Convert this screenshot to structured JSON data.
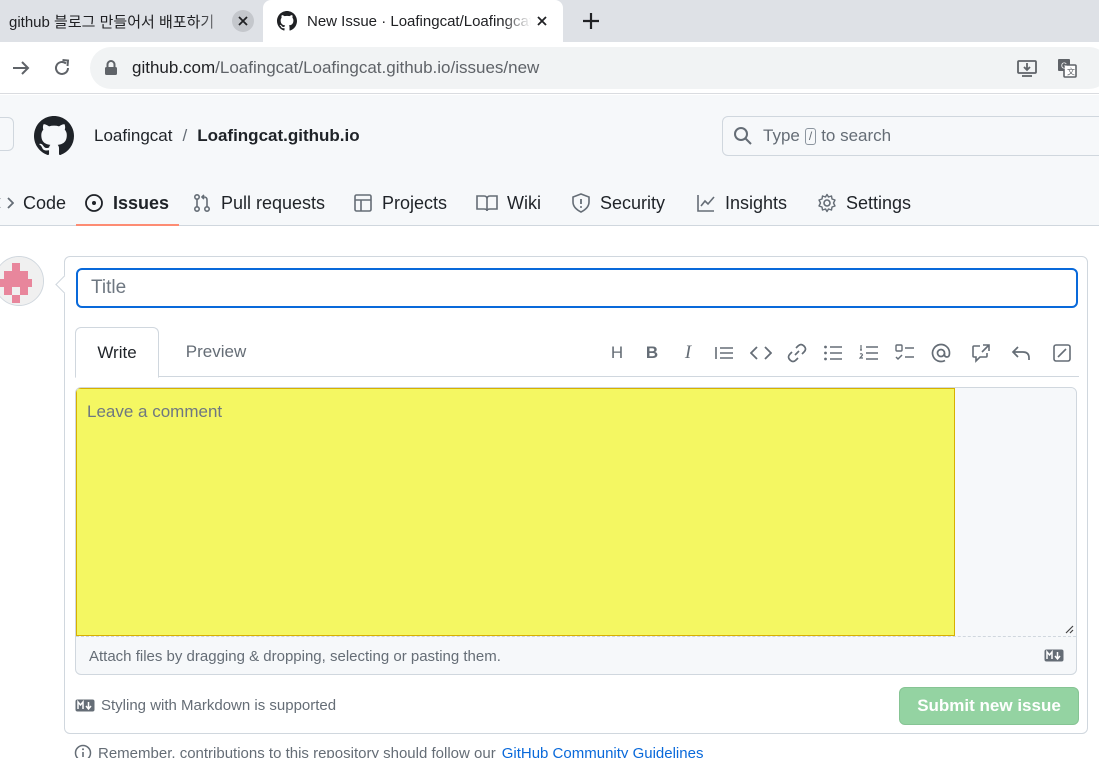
{
  "browser": {
    "tabs": [
      {
        "title": "github 블로그 만들어서 배포하기"
      },
      {
        "title": "New Issue · Loafingcat/Loafingcat.github.io"
      }
    ],
    "url_host": "github.com",
    "url_path": "/Loafingcat/Loafingcat.github.io/issues/new"
  },
  "header": {
    "owner": "Loafingcat",
    "separator": "/",
    "repo": "Loafingcat.github.io",
    "search_prefix": "Type",
    "search_key": "/",
    "search_suffix": "to search"
  },
  "repo_nav": [
    {
      "label": "Code",
      "icon": "code-icon"
    },
    {
      "label": "Issues",
      "icon": "issue-opened-icon",
      "selected": true
    },
    {
      "label": "Pull requests",
      "icon": "pull-request-icon"
    },
    {
      "label": "Projects",
      "icon": "table-icon"
    },
    {
      "label": "Wiki",
      "icon": "book-icon"
    },
    {
      "label": "Security",
      "icon": "shield-icon"
    },
    {
      "label": "Insights",
      "icon": "graph-icon"
    },
    {
      "label": "Settings",
      "icon": "gear-icon"
    }
  ],
  "form": {
    "title_placeholder": "Title",
    "title_value": "",
    "tab_write": "Write",
    "tab_preview": "Preview",
    "comment_placeholder": "Leave a comment",
    "attach_text": "Attach files by dragging & dropping, selecting or pasting them.",
    "markdown_note": "Styling with Markdown is supported",
    "submit_label": "Submit new issue",
    "toolbar": {
      "heading": "H",
      "bold": "B",
      "italic": "I"
    }
  },
  "footer": {
    "remember_text": "Remember, contributions to this repository should follow our",
    "guidelines_link": "GitHub Community Guidelines"
  },
  "colors": {
    "accent_blue": "#0969da",
    "selected_underline": "#fd8c73",
    "highlight_yellow": "#f4f762",
    "submit_disabled": "#94d3a2"
  }
}
